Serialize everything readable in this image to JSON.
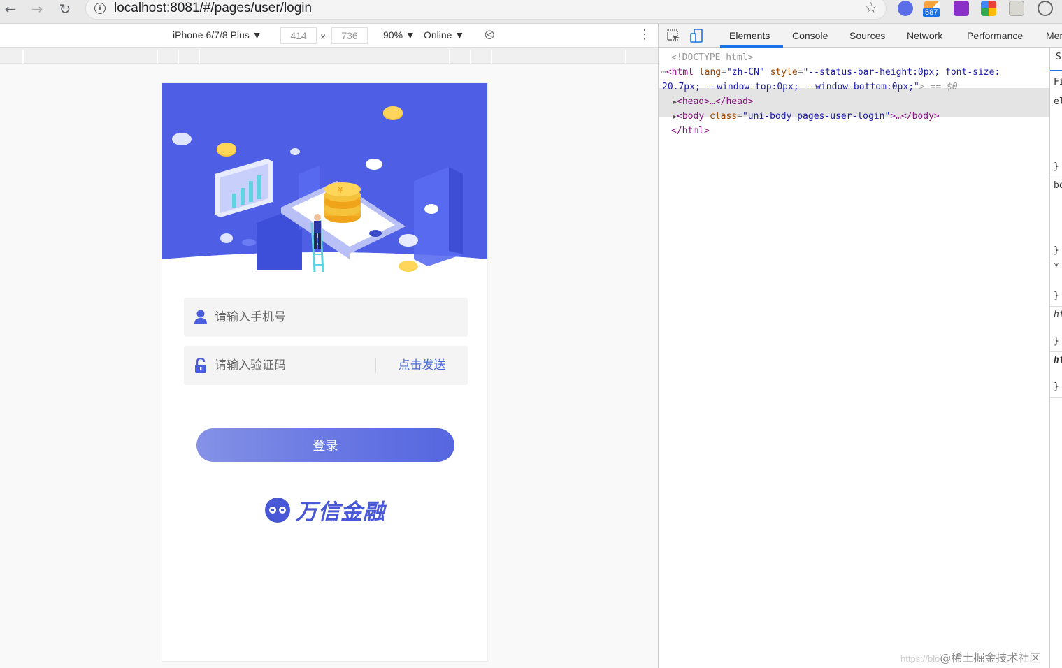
{
  "browser": {
    "url": "localhost:8081/#/pages/user/login",
    "extension_badge": "587"
  },
  "device_toolbar": {
    "device": "iPhone 6/7/8 Plus ▼",
    "width": "414",
    "height": "736",
    "times": "×",
    "zoom": "90% ▼",
    "network": "Online ▼"
  },
  "login": {
    "phone_placeholder": "请输入手机号",
    "code_placeholder": "请输入验证码",
    "send_code": "点击发送",
    "submit": "登录",
    "brand": "万信金融"
  },
  "devtools": {
    "tabs": [
      "Elements",
      "Console",
      "Sources",
      "Network",
      "Performance",
      "Mer"
    ],
    "doctype": "<!DOCTYPE html>",
    "html_line_1_prefix": "<html",
    "html_lang_attr": "lang",
    "html_lang_val": "\"zh-CN\"",
    "html_style_attr": "style",
    "html_style_val_1": "\"--status-bar-height:0px; font-size:",
    "html_style_val_2": "20.7px; --window-top:0px; --window-bottom:0px;\"",
    "html_suffix": "> == $0",
    "head": "<head>…</head>",
    "body_open": "<body",
    "body_class_attr": "class",
    "body_class_val": "\"uni-body pages-user-login\"",
    "body_close": ">…</body>",
    "html_close": "</html>",
    "styles_fragments": [
      "S",
      "Fi",
      "el",
      "}",
      "bo",
      "}",
      "*",
      "}",
      "ht",
      "}",
      "ht",
      "}"
    ]
  },
  "watermark": {
    "faint": "https://blo",
    "text": "@稀土掘金技术社区"
  },
  "colors": {
    "hero_blue": "#4e5fe6",
    "accent": "#4a6bd8",
    "button_start": "#8592e6",
    "button_end": "#5566e0",
    "coin_gold": "#f5c23b"
  }
}
